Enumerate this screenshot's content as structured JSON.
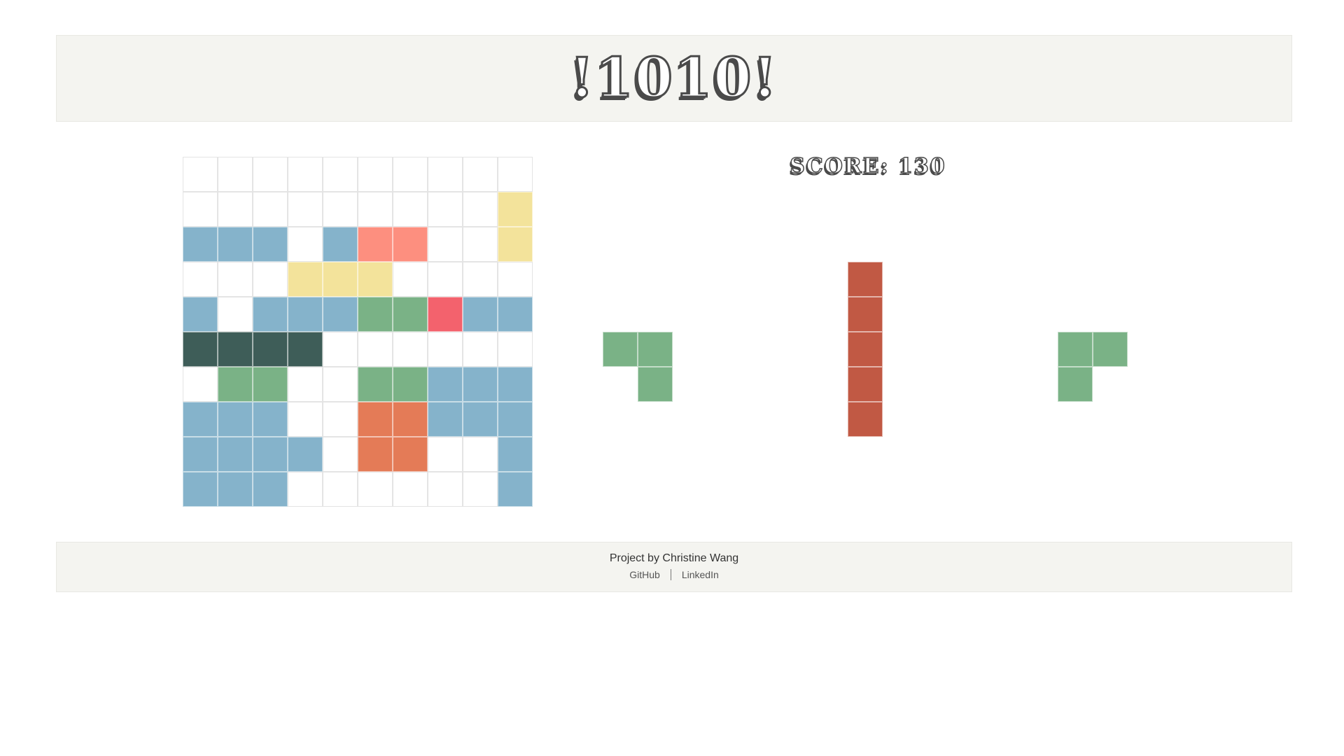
{
  "header": {
    "title": "!1010!"
  },
  "score": {
    "text": "SCORE: 130",
    "value": 130
  },
  "colors": {
    "empty": "#ffffff",
    "blue": "#85b3cb",
    "yellow": "#f3e39b",
    "salmon": "#fd8f7f",
    "green": "#7ab286",
    "red": "#f3626d",
    "darkgreen": "#3e5d58",
    "orange": "#e47b57",
    "brick": "#c15944"
  },
  "board": [
    [
      "empty",
      "empty",
      "empty",
      "empty",
      "empty",
      "empty",
      "empty",
      "empty",
      "empty",
      "empty"
    ],
    [
      "empty",
      "empty",
      "empty",
      "empty",
      "empty",
      "empty",
      "empty",
      "empty",
      "empty",
      "yellow"
    ],
    [
      "blue",
      "blue",
      "blue",
      "empty",
      "blue",
      "salmon",
      "salmon",
      "empty",
      "empty",
      "yellow"
    ],
    [
      "empty",
      "empty",
      "empty",
      "yellow",
      "yellow",
      "yellow",
      "empty",
      "empty",
      "empty",
      "empty"
    ],
    [
      "blue",
      "empty",
      "blue",
      "blue",
      "blue",
      "green",
      "green",
      "red",
      "blue",
      "blue"
    ],
    [
      "darkgreen",
      "darkgreen",
      "darkgreen",
      "darkgreen",
      "empty",
      "empty",
      "empty",
      "empty",
      "empty",
      "empty"
    ],
    [
      "empty",
      "green",
      "green",
      "empty",
      "empty",
      "green",
      "green",
      "blue",
      "blue",
      "blue"
    ],
    [
      "blue",
      "blue",
      "blue",
      "empty",
      "empty",
      "orange",
      "orange",
      "blue",
      "blue",
      "blue"
    ],
    [
      "blue",
      "blue",
      "blue",
      "blue",
      "empty",
      "orange",
      "orange",
      "empty",
      "empty",
      "blue"
    ],
    [
      "blue",
      "blue",
      "blue",
      "empty",
      "empty",
      "empty",
      "empty",
      "empty",
      "empty",
      "blue"
    ]
  ],
  "pieces": [
    {
      "color": "green",
      "cells": [
        "green",
        "green",
        "empty",
        "green"
      ]
    },
    {
      "color": "brick",
      "cells": [
        "brick",
        "brick",
        "brick",
        "brick",
        "brick"
      ]
    },
    {
      "color": "green",
      "cells": [
        "green",
        "green",
        "green",
        "empty"
      ]
    }
  ],
  "footer": {
    "credit": "Project by Christine Wang",
    "links": [
      "GitHub",
      "LinkedIn"
    ]
  }
}
